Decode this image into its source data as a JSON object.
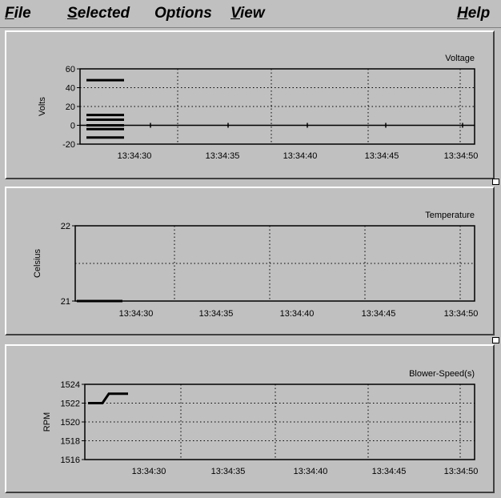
{
  "menu": {
    "file": {
      "acc": "F",
      "rest": "ile"
    },
    "selected": {
      "acc": "S",
      "rest": "elected"
    },
    "options": {
      "label": "Options"
    },
    "view": {
      "acc": "V",
      "rest": "iew"
    },
    "help": {
      "acc": "H",
      "rest": "elp"
    }
  },
  "chart_data": [
    {
      "type": "line",
      "title": "Voltage",
      "ylabel": "Volts",
      "xlabel": "",
      "ylim": [
        -20,
        60
      ],
      "yticks": [
        "60",
        "40",
        "20",
        "0",
        "-20"
      ],
      "ytick_values": [
        60,
        40,
        20,
        0,
        -20
      ],
      "xticks": [
        "13:34:30",
        "13:34:35",
        "13:34:40",
        "13:34:45",
        "13:34:50"
      ],
      "grid": true,
      "series": [
        {
          "values": [
            48,
            48
          ]
        },
        {
          "values": [
            11,
            11
          ]
        },
        {
          "values": [
            6,
            6
          ]
        },
        {
          "values": [
            0,
            0
          ]
        },
        {
          "values": [
            -4,
            -4
          ]
        },
        {
          "values": [
            -13,
            -13
          ]
        }
      ]
    },
    {
      "type": "line",
      "title": "Temperature",
      "ylabel": "Celsius",
      "xlabel": "",
      "ylim": [
        21,
        22
      ],
      "yticks": [
        "22",
        "21"
      ],
      "ytick_values": [
        22,
        21
      ],
      "xticks": [
        "13:34:30",
        "13:34:35",
        "13:34:40",
        "13:34:45",
        "13:34:50"
      ],
      "grid": true,
      "series": [
        {
          "values": [
            21,
            21
          ]
        }
      ]
    },
    {
      "type": "line",
      "title": "Blower-Speed(s)",
      "ylabel": "RPM",
      "xlabel": "",
      "ylim": [
        1516,
        1524
      ],
      "yticks": [
        "1524",
        "1522",
        "1520",
        "1518",
        "1516"
      ],
      "ytick_values": [
        1524,
        1522,
        1520,
        1518,
        1516
      ],
      "xticks": [
        "13:34:30",
        "13:34:35",
        "13:34:40",
        "13:34:45",
        "13:34:50"
      ],
      "grid": true,
      "series": [
        {
          "values": [
            1522,
            1522,
            1523,
            1523
          ]
        }
      ]
    }
  ]
}
